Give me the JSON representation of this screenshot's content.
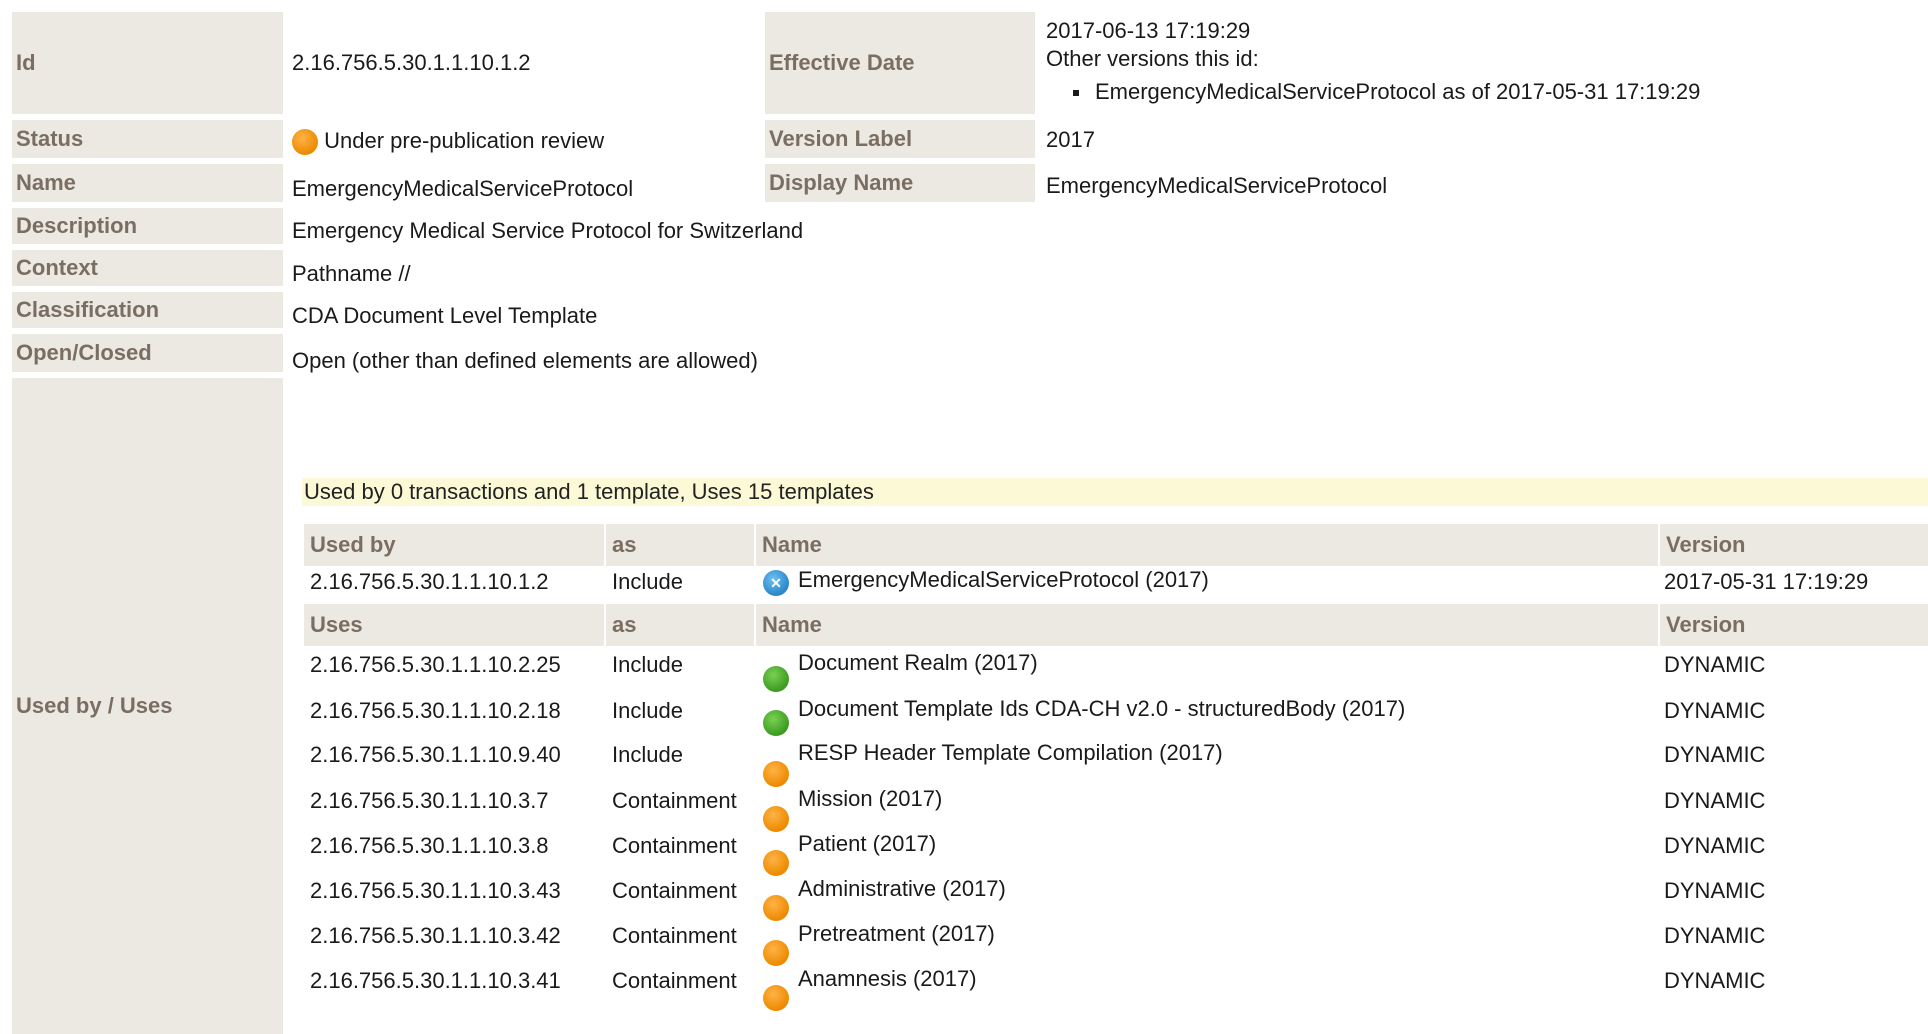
{
  "properties": {
    "id": {
      "label": "Id",
      "value": "2.16.756.5.30.1.1.10.1.2"
    },
    "effective_date": {
      "label": "Effective Date",
      "value": "2017-06-13 17:19:29",
      "other_versions_label": "Other versions this id:",
      "other_versions": [
        "EmergencyMedicalServiceProtocol as of 2017-05-31 17:19:29"
      ]
    },
    "status": {
      "label": "Status",
      "value": "Under pre-publication review",
      "icon": "status-orange-icon"
    },
    "version_label": {
      "label": "Version Label",
      "value": "2017"
    },
    "name": {
      "label": "Name",
      "value": "EmergencyMedicalServiceProtocol"
    },
    "display_name": {
      "label": "Display Name",
      "value": "EmergencyMedicalServiceProtocol"
    },
    "description": {
      "label": "Description",
      "value": "Emergency Medical Service Protocol for Switzerland"
    },
    "context": {
      "label": "Context",
      "value": "Pathname //"
    },
    "classification": {
      "label": "Classification",
      "value": "CDA Document Level Template"
    },
    "open_closed": {
      "label": "Open/Closed",
      "value": "Open (other than defined elements are allowed)"
    },
    "used_by_uses": {
      "label": "Used by / Uses"
    }
  },
  "usage": {
    "summary": "Used by 0 transactions and 1 template, Uses 15 templates",
    "used_by_headers": {
      "id": "Used by",
      "as": "as",
      "name": "Name",
      "version": "Version"
    },
    "used_by": [
      {
        "id": "2.16.756.5.30.1.1.10.1.2",
        "as": "Include",
        "name": "EmergencyMedicalServiceProtocol (2017)",
        "version": "2017-05-31 17:19:29",
        "icon": "status-blue-cancelled-icon"
      }
    ],
    "uses_headers": {
      "id": "Uses",
      "as": "as",
      "name": "Name",
      "version": "Version"
    },
    "uses": [
      {
        "id": "2.16.756.5.30.1.1.10.2.25",
        "as": "Include",
        "name": "Document Realm (2017)",
        "version": "DYNAMIC",
        "icon": "status-green-icon"
      },
      {
        "id": "2.16.756.5.30.1.1.10.2.18",
        "as": "Include",
        "name": "Document Template Ids CDA-CH v2.0 - structuredBody (2017)",
        "version": "DYNAMIC",
        "icon": "status-green-icon"
      },
      {
        "id": "2.16.756.5.30.1.1.10.9.40",
        "as": "Include",
        "name": "RESP Header Template Compilation (2017)",
        "version": "DYNAMIC",
        "icon": "status-orange-icon"
      },
      {
        "id": "2.16.756.5.30.1.1.10.3.7",
        "as": "Containment",
        "name": "Mission (2017)",
        "version": "DYNAMIC",
        "icon": "status-orange-icon"
      },
      {
        "id": "2.16.756.5.30.1.1.10.3.8",
        "as": "Containment",
        "name": "Patient (2017)",
        "version": "DYNAMIC",
        "icon": "status-orange-icon"
      },
      {
        "id": "2.16.756.5.30.1.1.10.3.43",
        "as": "Containment",
        "name": "Administrative (2017)",
        "version": "DYNAMIC",
        "icon": "status-orange-icon"
      },
      {
        "id": "2.16.756.5.30.1.1.10.3.42",
        "as": "Containment",
        "name": "Pretreatment (2017)",
        "version": "DYNAMIC",
        "icon": "status-orange-icon"
      },
      {
        "id": "2.16.756.5.30.1.1.10.3.41",
        "as": "Containment",
        "name": "Anamnesis (2017)",
        "version": "DYNAMIC",
        "icon": "status-orange-icon"
      }
    ]
  },
  "colors": {
    "label_background": "#ece9e3",
    "label_text": "#7a6e62",
    "banner_background": "#fbf9d6",
    "status_orange": "#ec8a00",
    "status_green": "#3c9a23",
    "status_blue": "#2b86c9"
  }
}
